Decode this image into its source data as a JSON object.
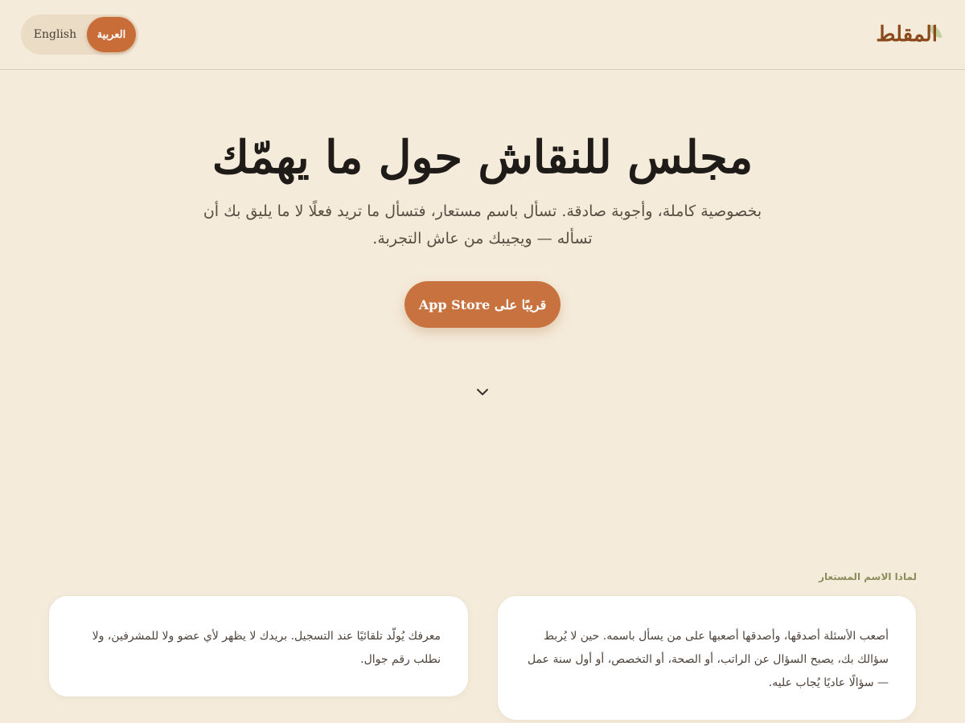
{
  "header": {
    "logo": "المقلط",
    "lang": {
      "english": "English",
      "arabic": "العربية",
      "active": "arabic"
    }
  },
  "hero": {
    "title": "مجلس للنقاش حول ما يهمّك",
    "subtitle": "بخصوصية كاملة، وأجوبة صادقة. تسأل باسم مستعار، فتسأل ما تريد فعلًا لا ما يليق بك أن تسأله — ويجيبك من عاش التجربة.",
    "cta": "قريبًا على App Store"
  },
  "section": {
    "kicker": "لماذا الاسم المستعار",
    "cards": [
      "أصعب الأسئلة أصدقها، وأصدقها أصعبها على من يسأل باسمه. حين لا يُربط سؤالك بك، يصبح السؤال عن الراتب، أو الصحة، أو التخصص، أو أول سنة عمل — سؤالًا عاديًا يُجاب عليه.",
      "معرفك يُولّد تلقائيًا عند التسجيل. بريدك لا يظهر لأي عضو ولا للمشرفين، ولا نطلب رقم جوال."
    ]
  },
  "colors": {
    "background": "#f5ebda",
    "accent": "#c8733f",
    "logo": "#8a4a1c",
    "kicker": "#8b8d5c"
  },
  "icons": {
    "scroll": "chevron-down-icon"
  }
}
